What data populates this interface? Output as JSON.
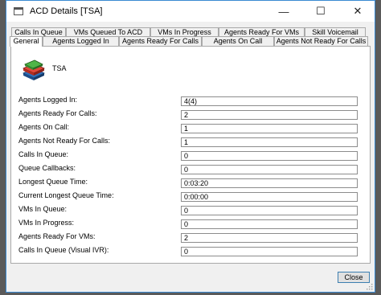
{
  "window": {
    "title": "ACD Details [TSA]"
  },
  "title_buttons": {
    "minimize": "—",
    "maximize": "☐",
    "close": "✕"
  },
  "tabs_row1": [
    "Calls In Queue",
    "VMs Queued To ACD",
    "VMs In Progress",
    "Agents Ready For VMs",
    "Skill Voicemail"
  ],
  "tabs_row2": [
    "General",
    "Agents Logged In",
    "Agents Ready For Calls",
    "Agents On Call",
    "Agents Not Ready For Calls"
  ],
  "active_tab": "General",
  "site": {
    "name": "TSA"
  },
  "fields": [
    {
      "label": "Agents Logged In:",
      "value": "4(4)"
    },
    {
      "label": "Agents Ready For Calls:",
      "value": "2"
    },
    {
      "label": "Agents On Call:",
      "value": "1"
    },
    {
      "label": "Agents Not Ready For Calls:",
      "value": "1"
    },
    {
      "label": "Calls In Queue:",
      "value": "0"
    },
    {
      "label": "Queue Callbacks:",
      "value": "0"
    },
    {
      "label": "Longest Queue Time:",
      "value": "0:03:20"
    },
    {
      "label": "Current Longest Queue Time:",
      "value": "0:00:00"
    },
    {
      "label": "VMs In Queue:",
      "value": "0"
    },
    {
      "label": "VMs In Progress:",
      "value": "0"
    },
    {
      "label": "Agents Ready For VMs:",
      "value": "2"
    },
    {
      "label": "Calls In Queue (Visual IVR):",
      "value": "0"
    }
  ],
  "buttons": {
    "close": "Close"
  }
}
